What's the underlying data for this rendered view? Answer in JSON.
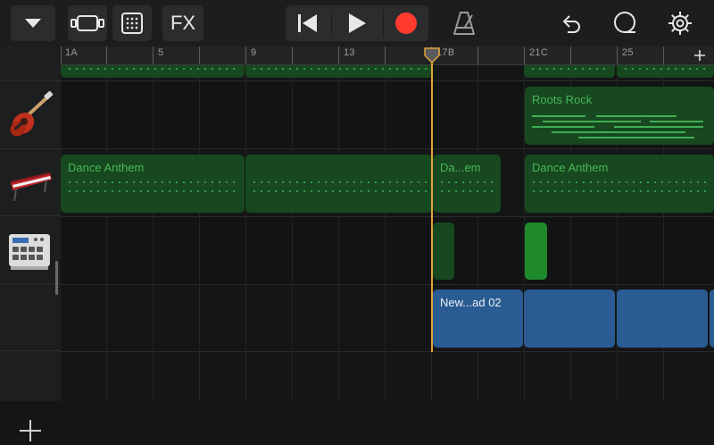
{
  "toolbar": {
    "fx_label": "FX"
  },
  "ruler": {
    "bar_labels": [
      "1A",
      "5",
      "9",
      "13",
      "17B",
      "21C",
      "25"
    ]
  },
  "regions": {
    "roots_rock": "Roots Rock",
    "dance_anthem_1": "Dance Anthem",
    "dance_anthem_short": "Da...em",
    "dance_anthem_2": "Dance Anthem",
    "audio": "New...ad 02"
  },
  "tracks": [
    {
      "instrument": "guitar-icon"
    },
    {
      "instrument": "keyboard-icon"
    },
    {
      "instrument": "drum-machine-icon"
    },
    {
      "instrument": "audio-recorder"
    }
  ],
  "colors": {
    "playhead": "#e2a43a",
    "record": "#ff3b30",
    "midi_region": "#17481f",
    "audio_region": "#2a5c93"
  }
}
